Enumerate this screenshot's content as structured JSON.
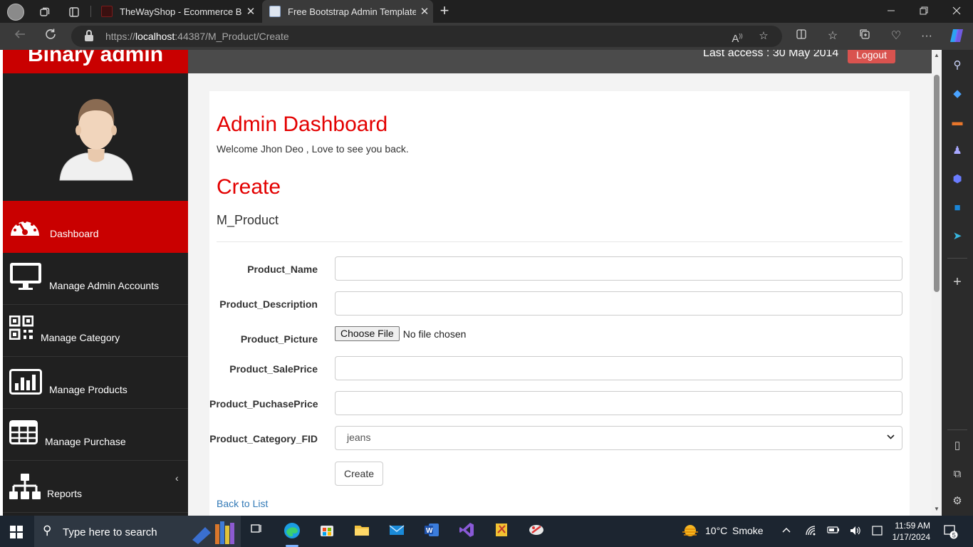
{
  "browser": {
    "tabs": [
      {
        "title": "TheWayShop - Ecommerce Bootstrap",
        "close": "✕"
      },
      {
        "title": "Free Bootstrap Admin Template :",
        "close": "✕"
      }
    ],
    "new_tab": "+",
    "url_prefix": "https://",
    "url_host": "localhost",
    "url_rest": ":44387/M_Product/Create"
  },
  "site": {
    "brand": "Binary admin",
    "last_access": "Last access : 30 May 2014",
    "logout": "Logout"
  },
  "sidebar": {
    "items": [
      {
        "label": "Dashboard",
        "icon": "dashboard-icon"
      },
      {
        "label": "Manage Admin Accounts",
        "icon": "desktop-icon"
      },
      {
        "label": "Manage Category",
        "icon": "qrcode-icon"
      },
      {
        "label": "Manage Products",
        "icon": "bar-chart-icon"
      },
      {
        "label": "Manage Purchase",
        "icon": "table-icon"
      },
      {
        "label": "Reports",
        "icon": "sitemap-icon"
      }
    ],
    "collapse": "‹"
  },
  "main": {
    "heading": "Admin Dashboard",
    "welcome": "Welcome Jhon Deo , Love to see you back.",
    "title": "Create",
    "model": "M_Product",
    "fields": [
      {
        "label": "Product_Name",
        "value": ""
      },
      {
        "label": "Product_Description",
        "value": ""
      },
      {
        "label": "Product_Picture",
        "button": "Choose File",
        "status": "No file chosen"
      },
      {
        "label": "Product_SalePrice",
        "value": ""
      },
      {
        "label": "Product_PuchasePrice",
        "value": ""
      },
      {
        "label": "Product_Category_FID",
        "selected": "jeans"
      }
    ],
    "create_button": "Create",
    "back_link": "Back to List"
  },
  "taskbar": {
    "search_placeholder": "Type here to search",
    "weather_temp": "10°C",
    "weather_desc": "Smoke",
    "time": "11:59 AM",
    "date": "1/17/2024",
    "notifications": "5"
  }
}
